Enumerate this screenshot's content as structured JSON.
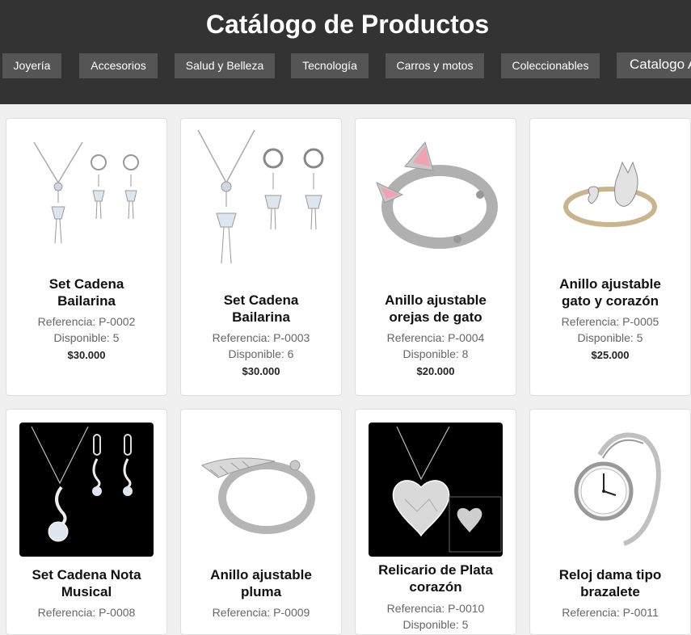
{
  "header": {
    "title": "Catálogo de Productos",
    "nav": [
      {
        "label": "Joyería"
      },
      {
        "label": "Accesorios"
      },
      {
        "label": "Salud y Belleza"
      },
      {
        "label": "Tecnología"
      },
      {
        "label": "Carros y motos"
      },
      {
        "label": "Coleccionables"
      },
      {
        "label": "Catalogo A"
      }
    ]
  },
  "products": [
    {
      "name": "Set Cadena Bailarina",
      "ref": "Referencia: P-0002",
      "avail": "Disponible: 5",
      "price": "$30.000",
      "icon": "necklace-earrings-set-icon"
    },
    {
      "name": "Set Cadena Bailarina",
      "ref": "Referencia: P-0003",
      "avail": "Disponible: 6",
      "price": "$30.000",
      "icon": "necklace-earrings-set-icon"
    },
    {
      "name": "Anillo ajustable orejas de gato",
      "ref": "Referencia: P-0004",
      "avail": "Disponible: 8",
      "price": "$20.000",
      "icon": "cat-ear-ring-icon"
    },
    {
      "name": "Anillo ajustable gato y corazón",
      "ref": "Referencia: P-0005",
      "avail": "Disponible: 5",
      "price": "$25.000",
      "icon": "cat-heart-ring-icon"
    },
    {
      "name": "Set Cadena Nota Musical",
      "ref": "Referencia: P-0008",
      "icon": "music-note-necklace-icon"
    },
    {
      "name": "Anillo ajustable pluma",
      "ref": "Referencia: P-0009",
      "icon": "feather-ring-icon"
    },
    {
      "name": "Relicario de Plata corazón",
      "ref": "Referencia: P-0010",
      "avail": "Disponible: 5",
      "icon": "heart-locket-icon"
    },
    {
      "name": "Reloj dama tipo brazalete",
      "ref": "Referencia: P-0011",
      "icon": "bracelet-watch-icon"
    }
  ]
}
